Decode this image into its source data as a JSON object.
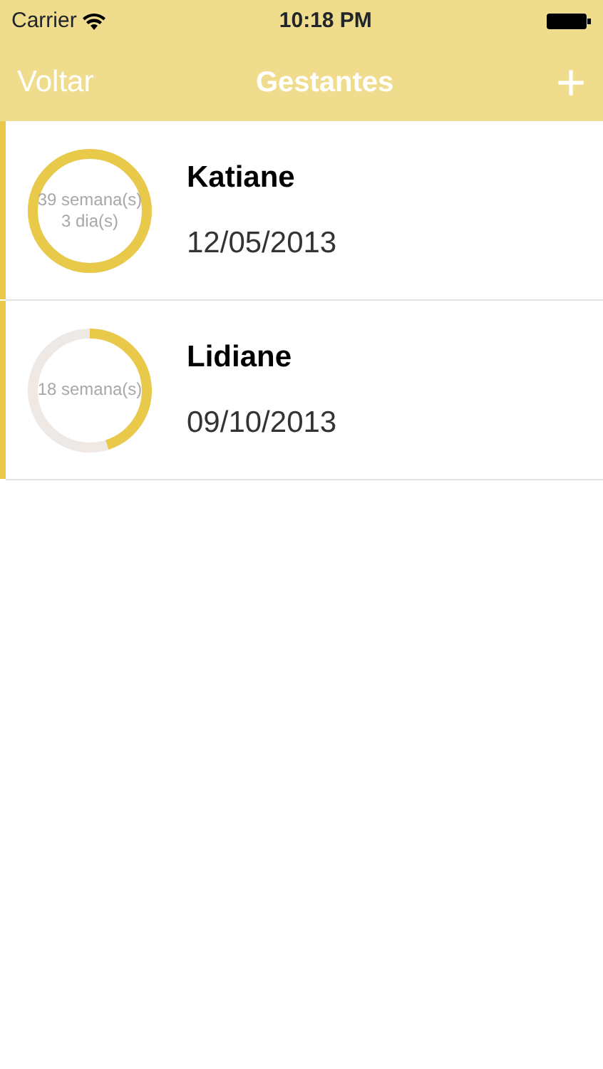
{
  "status_bar": {
    "carrier": "Carrier",
    "time": "10:18 PM"
  },
  "nav_bar": {
    "back": "Voltar",
    "title": "Gestantes",
    "add": "+"
  },
  "patients": [
    {
      "name": "Katiane",
      "date": "12/05/2013",
      "ring_lines": [
        "39 semana(s)",
        "3 dia(s)"
      ],
      "level": 1.0
    },
    {
      "name": "Lidiane",
      "date": "09/10/2013",
      "ring_lines": [
        "18 semana(s)"
      ],
      "level": 0.45
    }
  ]
}
